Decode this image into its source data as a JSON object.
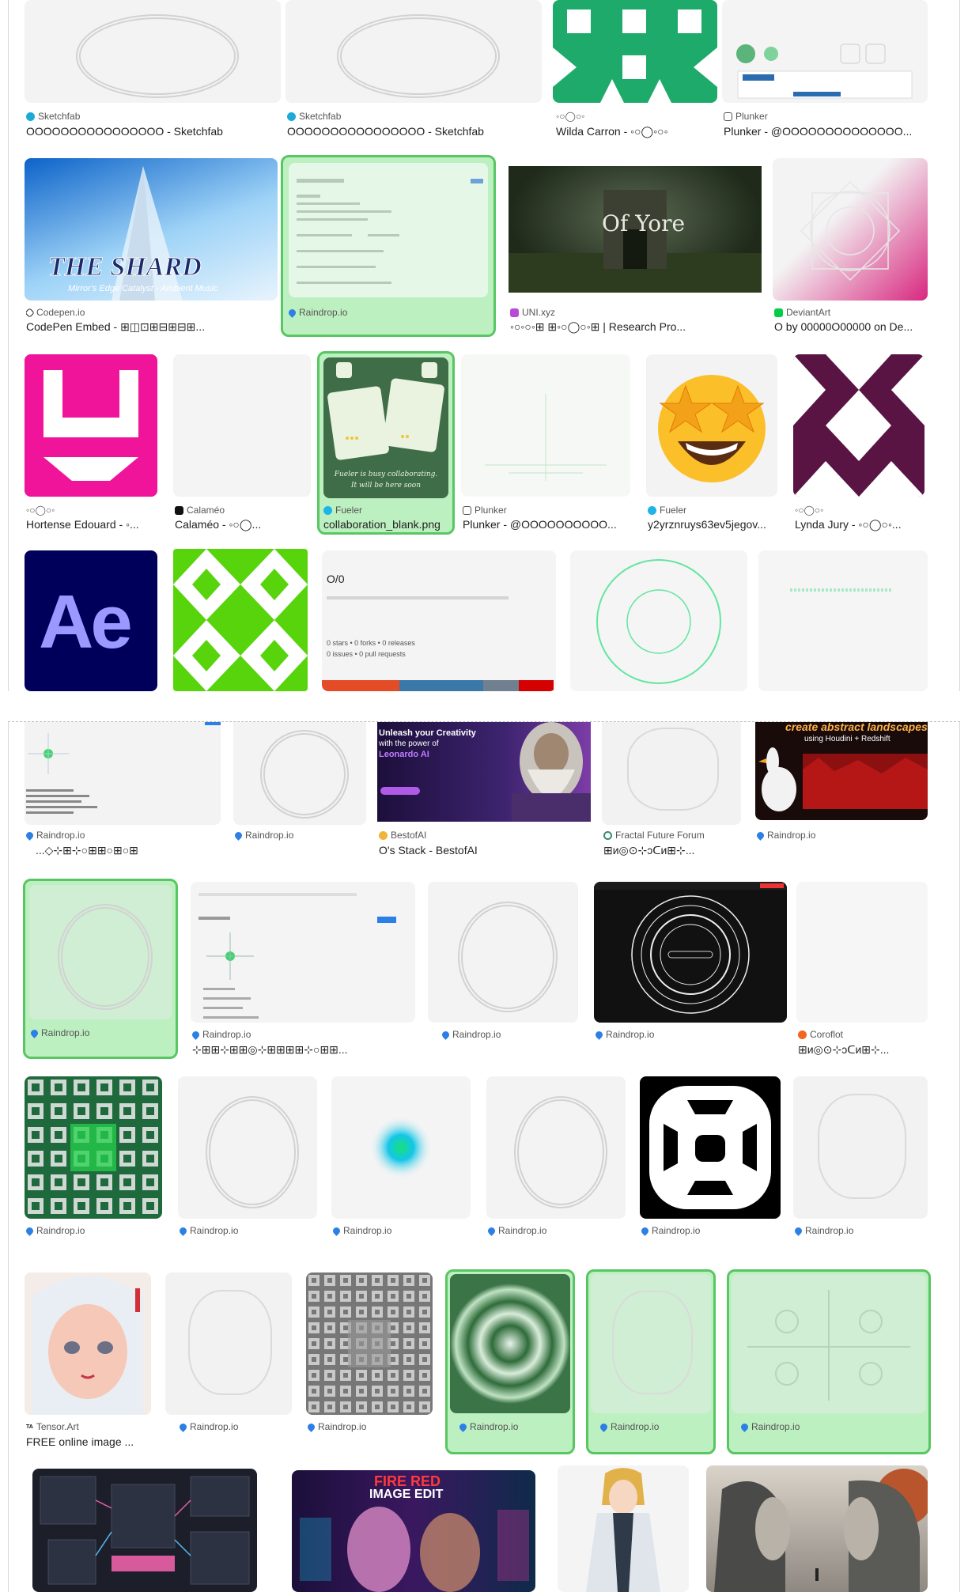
{
  "colors": {
    "selected_bg": "#bdf0c0",
    "selected_border": "#58c663",
    "raindrop": "#2b7fe6"
  },
  "top": {
    "row1": [
      {
        "source": "Sketchfab",
        "title": "OOOOOOOOOOOOOOOO - Sketchfab"
      },
      {
        "source": "Sketchfab",
        "title": "OOOOOOOOOOOOOOOO - Sketchfab"
      },
      {
        "source": "◦○◯○◦",
        "title": "Wilda Carron - ◦○◯◦○◦"
      },
      {
        "source": "Plunker",
        "title": "Plunker - @OOOOOOOOOOOOOO..."
      }
    ],
    "row2": [
      {
        "source": "Codepen.io",
        "title": "CodePen Embed - ⊞◫⊡⊞⊟⊞⊟⊞..."
      },
      {
        "source": "Raindrop.io",
        "title": ""
      },
      {
        "source": "UNI.xyz",
        "title": "◦○◦○◦⊞ ⊞◦○◯○◦⊞ | Research Pro..."
      },
      {
        "source": "DeviantArt",
        "title": "O by 00000O00000 on De..."
      }
    ],
    "row3": [
      {
        "source": "◦○◯○◦",
        "title": "Hortense Edouard - ◦..."
      },
      {
        "source": "Calaméo",
        "title": "Calaméo - ◦○◯..."
      },
      {
        "source": "Fueler",
        "title": "collaboration_blank.png",
        "thumb_caption": "Fueler is busy collaborating. It will be here soon"
      },
      {
        "source": "Plunker",
        "title": "Plunker - @OOOOOOOOOO..."
      },
      {
        "source": "Fueler",
        "title": "y2yrznruys63ev5jegov..."
      },
      {
        "source": "◦○◯○◦",
        "title": "Lynda Jury - ◦○◯○◦..."
      }
    ],
    "row4": {
      "ae_label": "Ae",
      "repo_title": "O/0",
      "repo_line1": "0 stars • 0 forks • 0 releases",
      "repo_line2": "0 issues • 0 pull requests"
    }
  },
  "bottom": {
    "row1": [
      {
        "source": "Raindrop.io",
        "title": "...◇⊹⊞⊹○⊞⊞○⊞○⊞"
      },
      {
        "source": "Raindrop.io",
        "title": ""
      },
      {
        "source": "BestofAI",
        "title": "O's Stack - BestofAI",
        "thumb_line1": "Unleash your Creativity",
        "thumb_line2": "with the power of",
        "thumb_line3": "Leonardo AI"
      },
      {
        "source": "Fractal Future Forum",
        "title": "⊞ᴎ◎⊙⊹ↄᑕᴎ⊞⊹..."
      },
      {
        "source": "Raindrop.io",
        "title": "",
        "thumb_line1": "create abstract landscapes",
        "thumb_line2": "using Houdini + Redshift"
      }
    ],
    "row2": [
      {
        "source": "Raindrop.io",
        "title": ""
      },
      {
        "source": "Raindrop.io",
        "title": "⊹⊞⊞⊹⊞⊞◎⊹⊞⊞⊞⊞⊹○⊞⊞..."
      },
      {
        "source": "Raindrop.io",
        "title": ""
      },
      {
        "source": "Raindrop.io",
        "title": ""
      },
      {
        "source": "Coroflot",
        "title": "⊞ᴎ◎⊙⊹ↄᑕᴎ⊞⊹..."
      }
    ],
    "row3": [
      {
        "source": "Raindrop.io"
      },
      {
        "source": "Raindrop.io"
      },
      {
        "source": "Raindrop.io"
      },
      {
        "source": "Raindrop.io"
      },
      {
        "source": "Raindrop.io"
      },
      {
        "source": "Raindrop.io"
      }
    ],
    "row4": [
      {
        "source": "Tensor.Art",
        "title": "FREE online image ..."
      },
      {
        "source": "Raindrop.io"
      },
      {
        "source": "Raindrop.io"
      },
      {
        "source": "Raindrop.io"
      },
      {
        "source": "Raindrop.io"
      },
      {
        "source": "Raindrop.io"
      }
    ],
    "row5": {
      "fire_line1": "FIRE RED",
      "fire_line2": "IMAGE EDIT"
    }
  }
}
